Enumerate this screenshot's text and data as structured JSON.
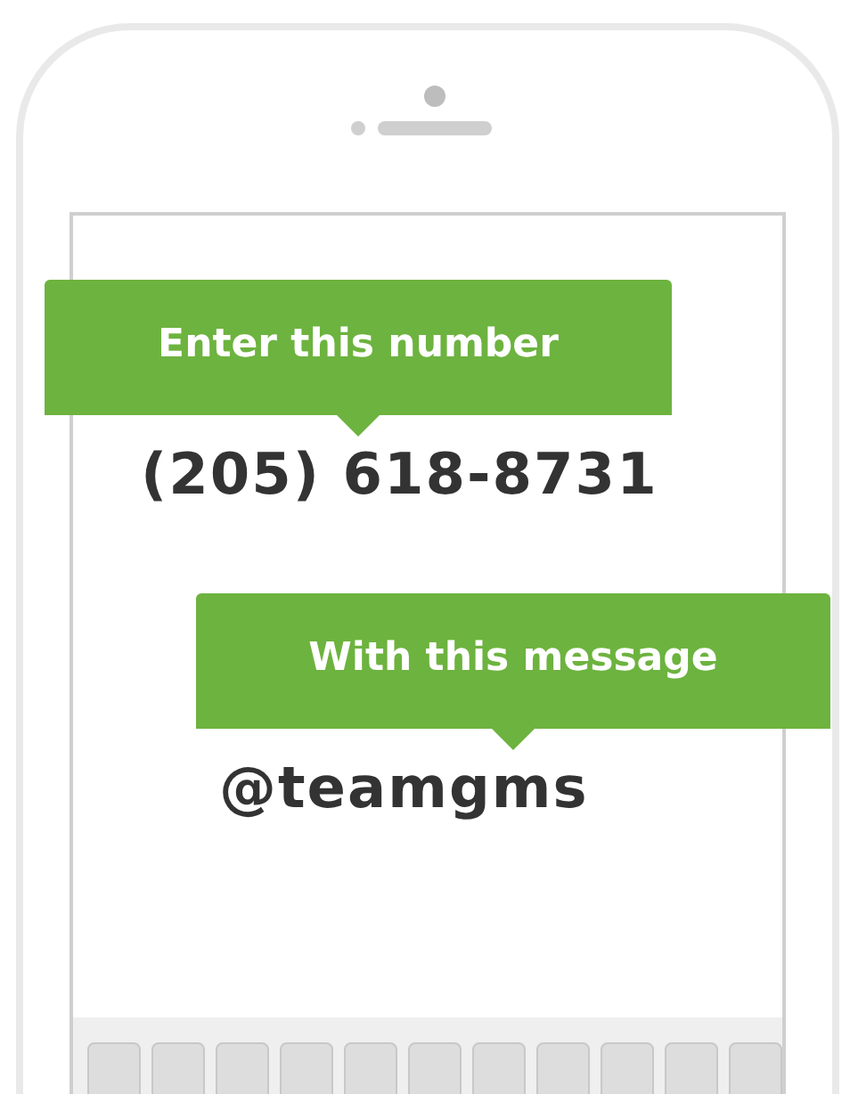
{
  "steps": [
    {
      "callout": "Enter this number",
      "value": "(205) 618-8731"
    },
    {
      "callout": "With this message",
      "value": "@teamgms"
    }
  ]
}
